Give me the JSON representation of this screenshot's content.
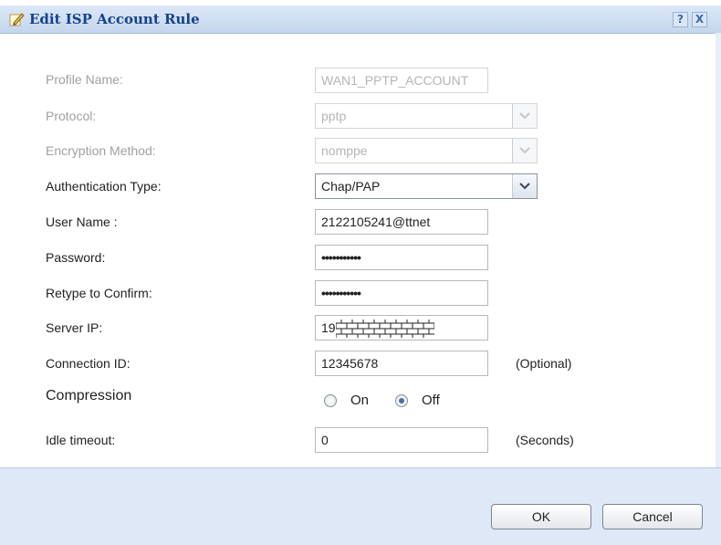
{
  "dialog": {
    "title": "Edit ISP Account Rule",
    "help_label": "?",
    "close_label": "X"
  },
  "form": {
    "profile_name": {
      "label": "Profile Name:",
      "value": "WAN1_PPTP_ACCOUNT"
    },
    "protocol": {
      "label": "Protocol:",
      "value": "pptp"
    },
    "encryption": {
      "label": "Encryption Method:",
      "value": "nomppe"
    },
    "auth_type": {
      "label": "Authentication Type:",
      "value": "Chap/PAP"
    },
    "user_name": {
      "label": "User Name :",
      "value": "2122105241@ttnet"
    },
    "password": {
      "label": "Password:",
      "value": "•••••••••••"
    },
    "retype": {
      "label": "Retype to Confirm:",
      "value": "•••••••••••"
    },
    "server_ip": {
      "label": "Server IP:",
      "value": "19"
    },
    "connection_id": {
      "label": "Connection ID:",
      "value": "12345678",
      "hint": "(Optional)"
    },
    "compression": {
      "label": "Compression",
      "on_label": "On",
      "off_label": "Off",
      "selected": "Off"
    },
    "idle_timeout": {
      "label": "Idle timeout:",
      "value": "0",
      "hint": "(Seconds)"
    }
  },
  "footer": {
    "ok_label": "OK",
    "cancel_label": "Cancel"
  },
  "colors": {
    "title_text": "#15428b",
    "footer_bg": "#dfe8f6"
  },
  "icons": [
    "edit-pencil-icon",
    "help-icon",
    "close-icon",
    "chevron-down-icon"
  ]
}
